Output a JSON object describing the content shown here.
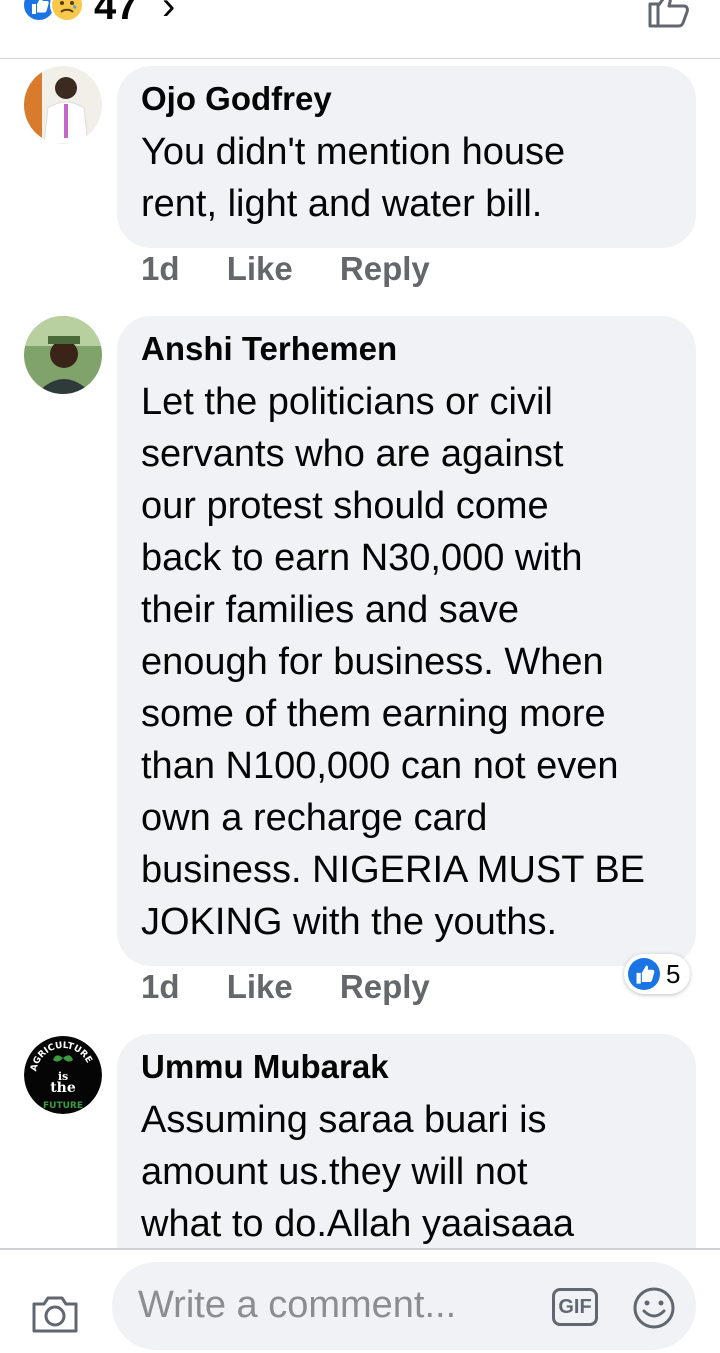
{
  "top_bar": {
    "reaction_count": "47",
    "chevron": "›",
    "icons": [
      "like-reaction-icon",
      "sad-reaction-icon",
      "like-outline-icon"
    ]
  },
  "comments": [
    {
      "author": "Ojo Godfrey",
      "text": "You didn't mention house\nrent, light and water bill.",
      "time": "1d",
      "like_label": "Like",
      "reply_label": "Reply"
    },
    {
      "author": "Anshi Terhemen",
      "text": "Let the politicians or civil\nservants who are against\nour protest should come\nback to earn  N30,000 with\ntheir families and save\nenough for business. When\nsome of them earning more\nthan N100,000 can not even\nown a recharge card\nbusiness. NIGERIA MUST BE\nJOKING with the youths.",
      "time": "1d",
      "like_label": "Like",
      "reply_label": "Reply",
      "reaction_count": "5"
    },
    {
      "author": "Ummu Mubarak",
      "text": "Assuming saraa buari is\namount us.they will not\nwhat to do.Allah yaaisaaa",
      "avatar_lines": [
        "AGRICULTURE",
        "is",
        "the",
        "FUTURE"
      ]
    }
  ],
  "composer": {
    "placeholder": "Write a comment...",
    "gif_label": "GIF",
    "icons": [
      "camera-icon",
      "gif-icon",
      "emoji-icon"
    ]
  },
  "colors": {
    "bubble": "#f0f2f5",
    "like_blue": "#1b74e4",
    "meta_gray": "#65676b"
  }
}
